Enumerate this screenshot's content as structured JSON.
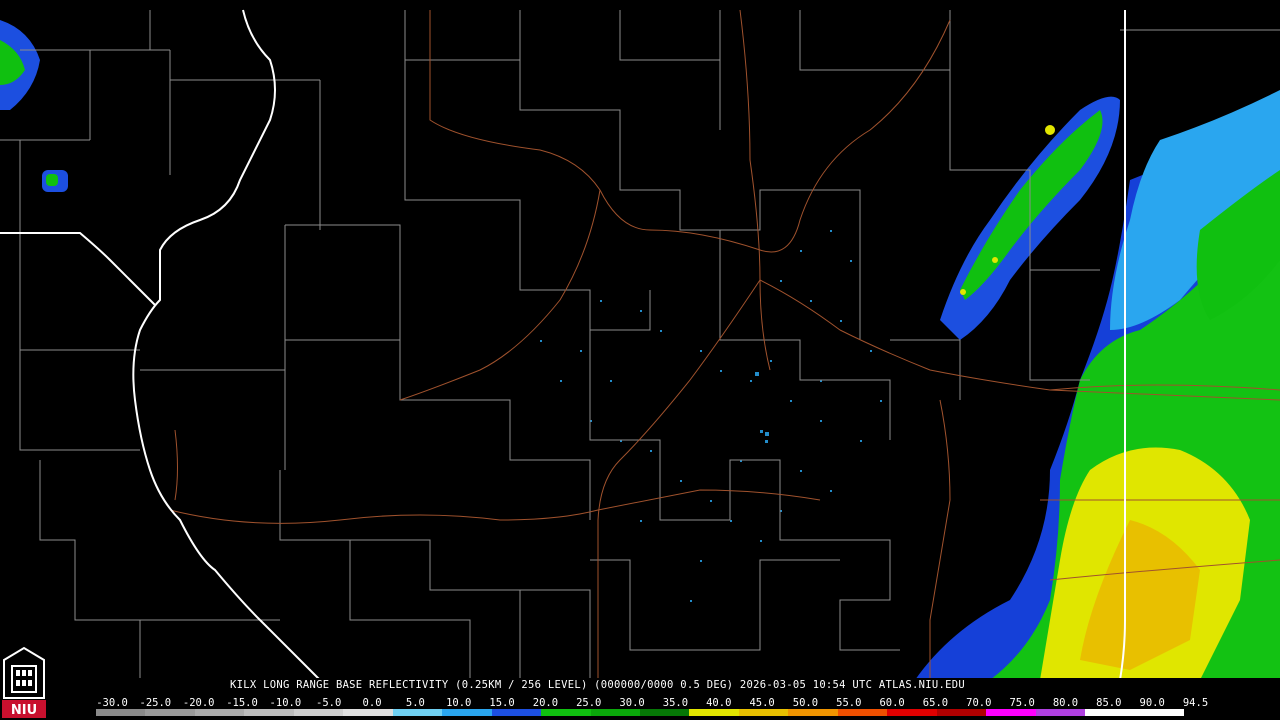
{
  "product": {
    "caption": "KILX LONG RANGE BASE REFLECTIVITY (0.25KM / 256 LEVEL) (000000/0000 0.5 DEG) 2026-03-05 10:54 UTC  ATLAS.NIU.EDU"
  },
  "scale": {
    "labels": [
      "-30.0",
      "-25.0",
      "-20.0",
      "-15.0",
      "-10.0",
      "-5.0",
      "0.0",
      "5.0",
      "10.0",
      "15.0",
      "20.0",
      "25.0",
      "30.0",
      "35.0",
      "40.0",
      "45.0",
      "50.0",
      "55.0",
      "60.0",
      "65.0",
      "70.0",
      "75.0",
      "80.0",
      "85.0",
      "90.0",
      "94.5"
    ],
    "colors": [
      "#8a8a8a",
      "#9a9a9a",
      "#aaaaaa",
      "#bcbcbc",
      "#cdcdcd",
      "#dedede",
      "#6fd0f2",
      "#2aa6ef",
      "#1c4fe0",
      "#10c010",
      "#0aa80a",
      "#067806",
      "#e2e600",
      "#e8c000",
      "#f09400",
      "#f05000",
      "#e00000",
      "#b00000",
      "#ff00ff",
      "#b040e0",
      "#ffffff",
      "#ffffff"
    ]
  },
  "logo": {
    "text": "NIU"
  },
  "colors": {
    "background": "#000000",
    "state_border": "#ffffff",
    "county_border": "#8c8c8c",
    "highway": "#a0522d"
  }
}
